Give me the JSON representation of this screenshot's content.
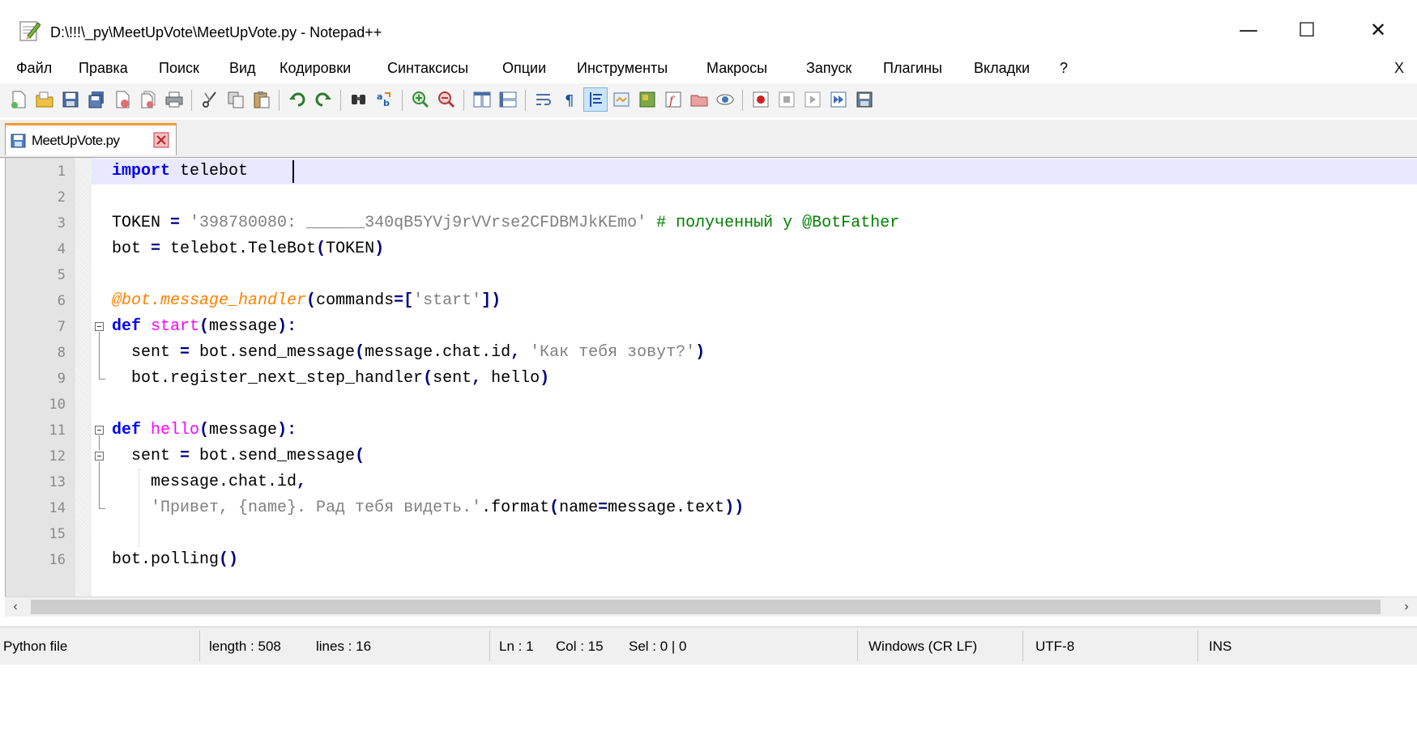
{
  "window": {
    "title": "D:\\!!!\\_py\\MeetUpVote\\MeetUpVote.py - Notepad++",
    "minimize_glyph": "—",
    "maximize_glyph": "☐",
    "close_glyph": "✕"
  },
  "menu": {
    "items": [
      "Файл",
      "Правка",
      "Поиск",
      "Вид",
      "Кодировки",
      "Синтаксисы",
      "Опции",
      "Инструменты",
      "Макросы",
      "Запуск",
      "Плагины",
      "Вкладки",
      "?"
    ],
    "close_doc_label": "X"
  },
  "toolbar": {
    "buttons": [
      "new-file-icon",
      "open-file-icon",
      "save-icon",
      "save-all-icon",
      "close-icon",
      "close-all-icon",
      "print-icon",
      "cut-icon",
      "copy-icon",
      "paste-icon",
      "undo-icon",
      "redo-icon",
      "find-icon",
      "replace-icon",
      "zoom-in-icon",
      "zoom-out-icon",
      "sync-vertical-icon",
      "sync-horizontal-icon",
      "word-wrap-icon",
      "show-all-chars-icon",
      "indent-guide-icon",
      "udl-icon",
      "doc-map-icon",
      "function-list-icon",
      "folder-workspace-icon",
      "monitoring-icon",
      "record-macro-icon",
      "stop-macro-icon",
      "play-macro-icon",
      "run-macro-multiple-icon",
      "save-macro-icon"
    ]
  },
  "tab": {
    "label": "MeetUpVote.py"
  },
  "editor": {
    "line_numbers": [
      "1",
      "2",
      "3",
      "4",
      "5",
      "6",
      "7",
      "8",
      "9",
      "10",
      "11",
      "12",
      "13",
      "14",
      "15",
      "16"
    ],
    "lines": {
      "l1": {
        "kw": "import",
        "rest": " telebot"
      },
      "l3": {
        "name": "TOKEN",
        "op": " = ",
        "str": "'398780080: ______340qB5YVj9rVVrse2CFDBMJkKEmo'",
        "comment": " # полученный у @BotFather"
      },
      "l4": {
        "a": "bot",
        "op1": " = ",
        "b": "telebot.TeleBot",
        "p1": "(",
        "c": "TOKEN",
        "p2": ")"
      },
      "l6": {
        "deco": "@bot.message_handler",
        "p1": "(",
        "a": "commands",
        "op": "=",
        "b1": "[",
        "str": "'start'",
        "b2": "]",
        "p2": ")"
      },
      "l7": {
        "kw": "def",
        "fn": " start",
        "p1": "(",
        "a": "message",
        "p2": ")",
        "colon": ":"
      },
      "l8": {
        "a": "  sent",
        "op": " = ",
        "b": "bot.send_message",
        "p1": "(",
        "c": "message.chat.id",
        "comma": ", ",
        "str": "'Как тебя зовут?'",
        "p2": ")"
      },
      "l9": {
        "a": "  bot.register_next_step_handler",
        "p1": "(",
        "b": "sent",
        "comma": ", ",
        "c": "hello",
        "p2": ")"
      },
      "l11": {
        "kw": "def",
        "fn": " hello",
        "p1": "(",
        "a": "message",
        "p2": ")",
        "colon": ":"
      },
      "l12": {
        "a": "  sent",
        "op": " = ",
        "b": "bot.send_message",
        "p1": "("
      },
      "l13": {
        "a": "    message.chat.id",
        "comma": ","
      },
      "l14": {
        "indent": "    ",
        "str": "'Привет, {name}. Рад тебя видеть.'",
        "b": ".format",
        "p1": "(",
        "c": "name",
        "op": "=",
        "d": "message.text",
        "p2": "))"
      },
      "l16": {
        "a": "bot.polling",
        "p": "()"
      }
    }
  },
  "status": {
    "file_type": "Python file",
    "length": "length : 508",
    "lines": "lines : 16",
    "ln": "Ln : 1",
    "col": "Col : 15",
    "sel": "Sel : 0 | 0",
    "eol": "Windows (CR LF)",
    "encoding": "UTF-8",
    "mode": "INS"
  },
  "colors": {
    "keyword": "#0000ff",
    "operator": "#000080",
    "string": "#808080",
    "comment": "#008000",
    "decorator": "#ff8000",
    "function_name": "#ff00ff",
    "current_line": "#e8e8ff",
    "tab_accent": "#f39c2c"
  }
}
